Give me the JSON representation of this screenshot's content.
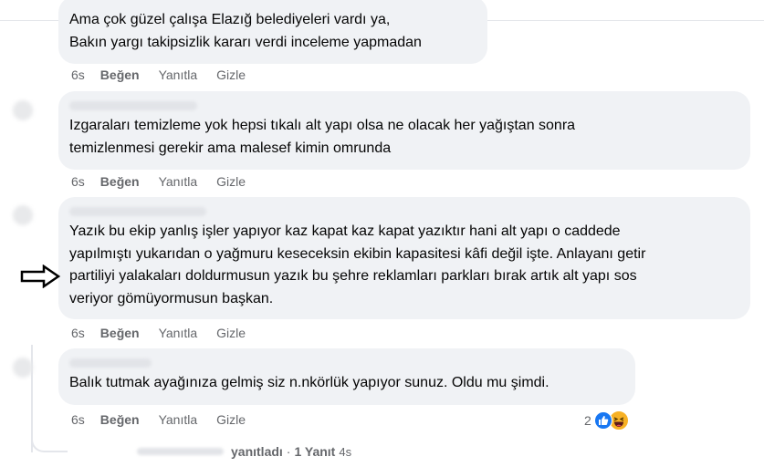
{
  "comments": [
    {
      "lines": [
        "Ama çok güzel çalışa Elazığ belediyeleri vardı ya,",
        "Bakın yargı takipsizlik kararı verdi inceleme yapmadan"
      ],
      "time": "6s",
      "like": "Beğen",
      "reply": "Yanıtla",
      "hide": "Gizle"
    },
    {
      "lines": [
        "Izgaraları temizleme yok hepsi tıkalı alt yapı olsa ne olacak her yağıştan sonra",
        "temizlenmesi gerekir ama malesef kimin omrunda"
      ],
      "time": "6s",
      "like": "Beğen",
      "reply": "Yanıtla",
      "hide": "Gizle"
    },
    {
      "lines": [
        "Yazık bu ekip yanlış işler yapıyor kaz kapat kaz kapat yazıktır hani alt yapı o caddede",
        "yapılmıştı yukarıdan o yağmuru keseceksin ekibin kapasitesi kâfi değil işte. Anlayanı getir",
        "partiliyi yalakaları doldurmusun yazık bu şehre reklamları parkları bırak artık alt yapı sos",
        "veriyor gömüyormusun başkan."
      ],
      "time": "6s",
      "like": "Beğen",
      "reply": "Yanıtla",
      "hide": "Gizle"
    },
    {
      "lines": [
        "Balık tutmak ayağınıza gelmiş siz n.nkörlük yapıyor sunuz. Oldu mu şimdi."
      ],
      "time": "6s",
      "like": "Beğen",
      "reply": "Yanıtla",
      "hide": "Gizle",
      "reaction_count": "2"
    }
  ],
  "reply_summary": {
    "text": "yanıtladı",
    "sep": "·",
    "count": "1 Yanıt",
    "time": "4s"
  },
  "colors": {
    "bubble": "#f0f2f5",
    "meta": "#65676b",
    "like_blue": "#1877f2",
    "haha_yellow": "#f7b125"
  },
  "icons": {
    "arrow": "right-arrow-outline-icon",
    "like": "like-reaction-icon",
    "haha": "haha-reaction-icon"
  }
}
